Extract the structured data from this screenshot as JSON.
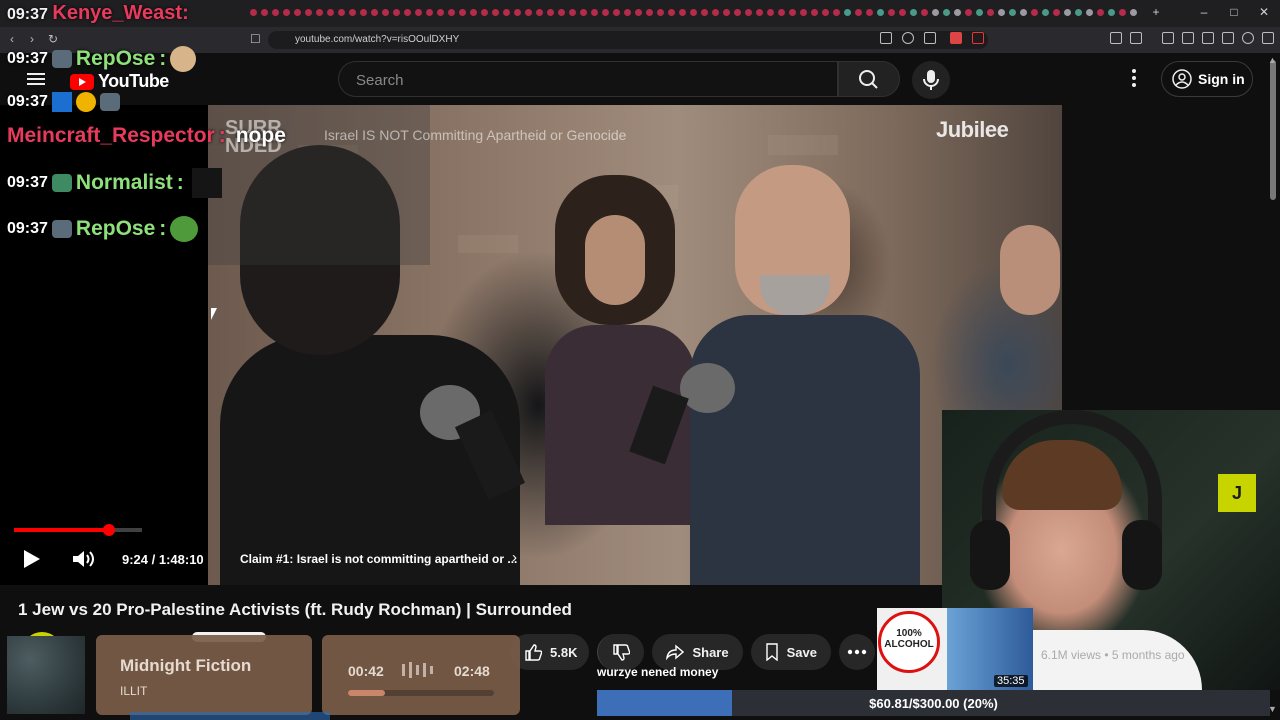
{
  "browser": {
    "url": "youtube.com/watch?v=risOOulDXHY",
    "stream_clock": "09:37",
    "title_overlay": "Kenye_Weast:"
  },
  "youtube": {
    "logo_text": "YouTube",
    "search_placeholder": "Search",
    "signin_label": "Sign in"
  },
  "player": {
    "overlay_brand": "SURR\nNDED",
    "overlay_title": "Israel IS NOT Committing Apartheid or Genocide",
    "channel_watermark": "Jubilee",
    "time": "9:24 / 1:48:10",
    "progress_fraction": 0.087,
    "chapter": "Claim #1: Israel is not committing apartheid or ...",
    "corner_logo": "J"
  },
  "chat": [
    {
      "time": "09:37",
      "name": "RepOse",
      "sep": ":",
      "message": "",
      "color": "#8ee07a"
    },
    {
      "time": "09:37",
      "name": "",
      "sep": "",
      "message": "",
      "color": "#ffffff"
    },
    {
      "time": "",
      "name": "Meincraft_Respector",
      "sep": ":",
      "message": "nope",
      "color": "#e83a5c"
    },
    {
      "time": "09:37",
      "name": "Normalist",
      "sep": ":",
      "message": "",
      "color": "#8ee07a"
    },
    {
      "time": "09:37",
      "name": "RepOse",
      "sep": ":",
      "message": "",
      "color": "#8ee07a"
    }
  ],
  "video": {
    "title": "1 Jew vs 20 Pro-Palestine Activists (ft. Rudy Rochman) | Surrounded",
    "likes": "5.8K",
    "share_label": "Share",
    "save_label": "Save"
  },
  "music": {
    "title": "Midnight Fiction",
    "artist": "ILLIT",
    "elapsed": "00:42",
    "total": "02:48",
    "progress_fraction": 0.25
  },
  "donation": {
    "message": "wurzye nened money",
    "goal_text": "$60.81/$300.00 (20%)",
    "goal_fraction": 0.2
  },
  "suggested": {
    "duration": "35:35",
    "meta": "6.1M views • 5 months ago",
    "thumb_text": "100% ALCOHOL"
  },
  "colors": {
    "youtube_red": "#ff0000",
    "goal_blue": "#3c6fb7",
    "chat_green": "#8ee07a",
    "chat_red": "#e83a5c",
    "jubilee_yellow": "#c8d400"
  }
}
